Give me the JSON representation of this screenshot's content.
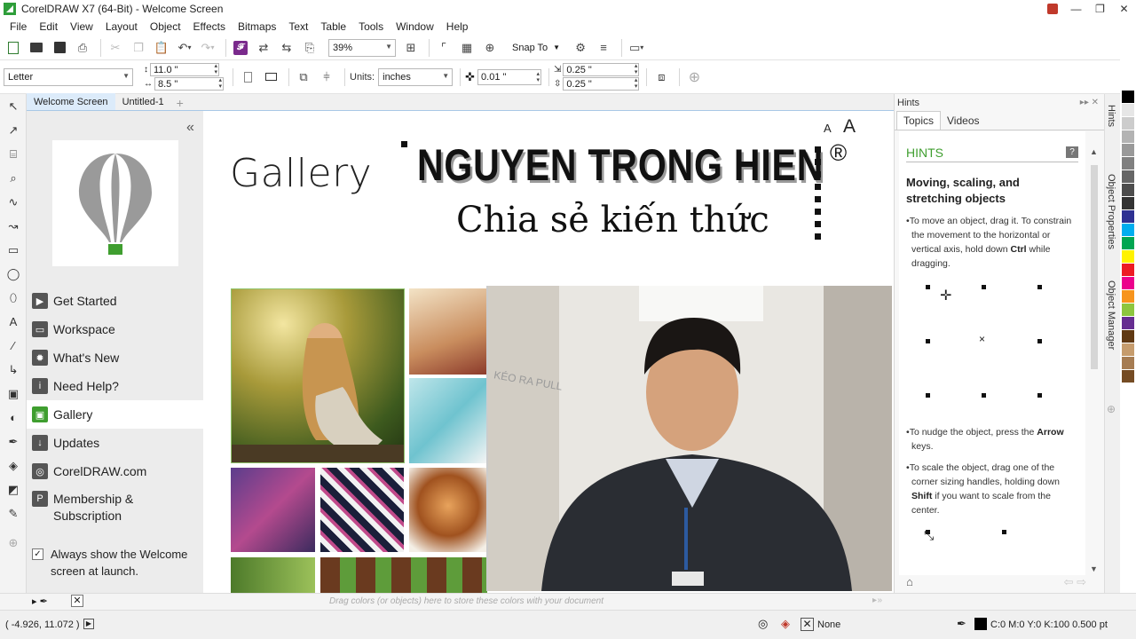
{
  "window": {
    "title": "CorelDRAW X7 (64-Bit) - Welcome Screen"
  },
  "menu": [
    "File",
    "Edit",
    "View",
    "Layout",
    "Object",
    "Effects",
    "Bitmaps",
    "Text",
    "Table",
    "Tools",
    "Window",
    "Help"
  ],
  "toolbar": {
    "zoom": "39%",
    "snap_to": "Snap To"
  },
  "property_bar": {
    "page_size": "Letter",
    "width": "11.0 \"",
    "height": "8.5 \"",
    "units_label": "Units:",
    "units": "inches",
    "nudge": "0.01 \"",
    "dup_x": "0.25 \"",
    "dup_y": "0.25 \""
  },
  "doc_tabs": [
    "Welcome Screen",
    "Untitled-1"
  ],
  "welcome": {
    "nav": [
      {
        "label": "Get Started",
        "icon": "arrow-icon"
      },
      {
        "label": "Workspace",
        "icon": "monitor-icon"
      },
      {
        "label": "What's New",
        "icon": "star-icon"
      },
      {
        "label": "Need Help?",
        "icon": "info-icon"
      },
      {
        "label": "Gallery",
        "icon": "gallery-icon"
      },
      {
        "label": "Updates",
        "icon": "download-icon"
      },
      {
        "label": "CorelDRAW.com",
        "icon": "globe-icon"
      },
      {
        "label": "Membership & Subscription",
        "icon": "membership-icon"
      }
    ],
    "always_show": "Always show the Welcome screen at launch.",
    "page_title": "Gallery",
    "font_small": "A",
    "font_large": "A"
  },
  "watermark": {
    "line1": "NGUYEN TRONG HIEN",
    "line2": "Chia sẻ kiến thức",
    "reg": "®"
  },
  "webcam_text": "KÉO RA PULL",
  "hints": {
    "panel_title": "Hints",
    "tabs": [
      "Topics",
      "Videos"
    ],
    "heading": "HINTS",
    "subheading": "Moving, scaling, and stretching objects",
    "p1_pre": "To move an object, drag it. To constrain the movement to the horizontal or vertical axis, hold down ",
    "p1_key": "Ctrl",
    "p1_post": " while dragging.",
    "p2_pre": "To nudge the object, press the ",
    "p2_key": "Arrow",
    "p2_post": " keys.",
    "p3_pre": "To scale the object, drag one of the corner sizing handles, holding down ",
    "p3_key": "Shift",
    "p3_post": " if you want to scale from the center."
  },
  "dockers": [
    "Hints",
    "Object Properties",
    "Object Manager"
  ],
  "colorbar_hint": "Drag colors (or objects) here to store these colors with your document",
  "status": {
    "coords": "( -4.926, 11.072 )",
    "fill": "None",
    "outline": "C:0 M:0 Y:0 K:100  0.500 pt"
  },
  "palette": [
    "#ffffff",
    "#000000",
    "#e6e6e6",
    "#cccccc",
    "#b3b3b3",
    "#999999",
    "#808080",
    "#666666",
    "#4d4d4d",
    "#333333",
    "#2e3192",
    "#00aeef",
    "#00a651",
    "#fff200",
    "#ed1c24",
    "#ec008c",
    "#f7941d",
    "#8dc63f",
    "#662d91",
    "#603913",
    "#c69c6d",
    "#a67c52",
    "#754c24",
    "#ffffff"
  ],
  "colors": {
    "accent_green": "#3f9e2f",
    "tab_active": "#dcebfa"
  }
}
